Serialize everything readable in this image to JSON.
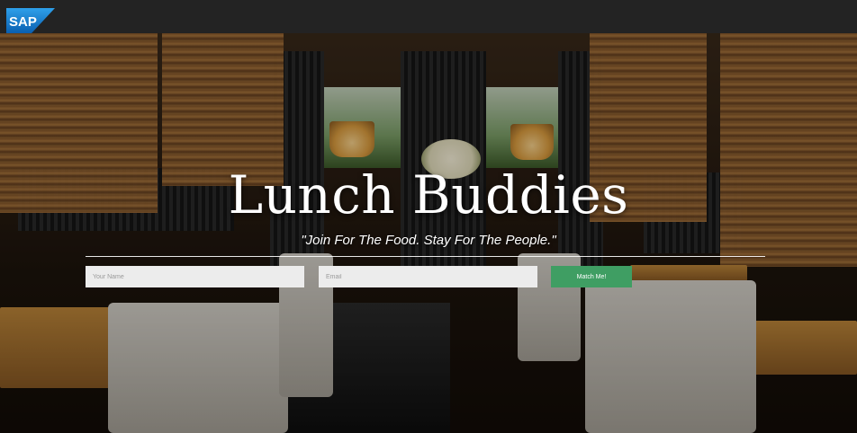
{
  "brand": {
    "logo_text": "SAP",
    "logo_color": "#1a73c8"
  },
  "hero": {
    "title": "Lunch Buddies",
    "tagline": "\"Join For The Food. Stay For The People.\""
  },
  "form": {
    "name_placeholder": "Your Name",
    "email_placeholder": "Email",
    "submit_label": "Match Me!",
    "submit_color": "#3f9e63"
  }
}
